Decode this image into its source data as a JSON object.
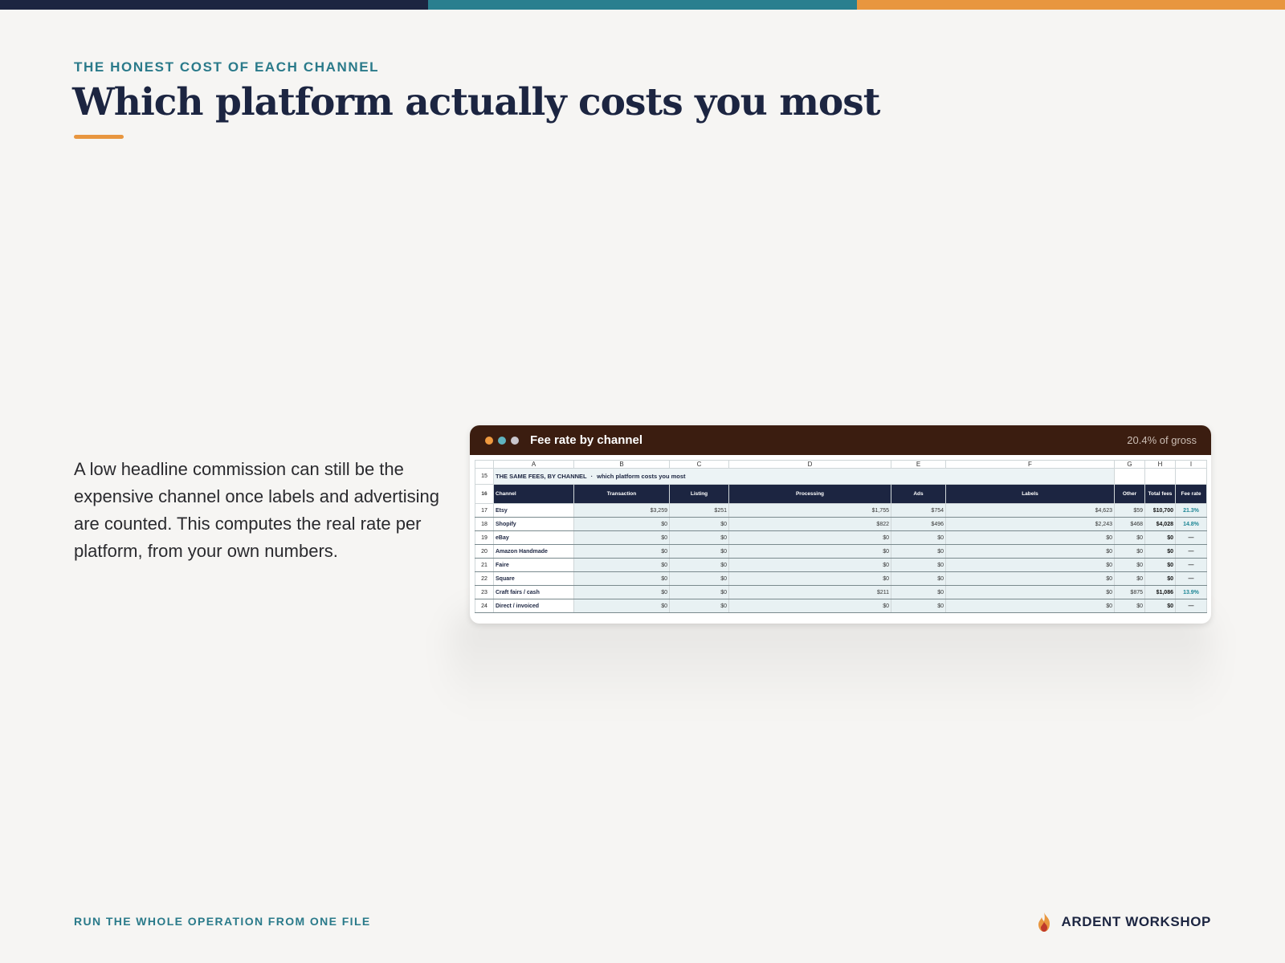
{
  "colors": {
    "navy": "#1c2541",
    "teal": "#2a7a8a",
    "orange": "#e8963f",
    "card_header": "#3b1d10",
    "dot_orange": "#ef9a3f",
    "dot_teal": "#5fb3bf",
    "dot_gray": "#c9c6cc",
    "rate_teal": "#1f8796"
  },
  "slide": {
    "eyebrow": "THE HONEST COST OF EACH CHANNEL",
    "title": "Which platform actually costs you most",
    "body": "A low headline commission can still be the expensive channel once labels and advertising are counted. This computes the real rate per platform, from your own numbers."
  },
  "card": {
    "title": "Fee rate by channel",
    "badge": "20.4% of gross"
  },
  "sheet": {
    "column_letters": [
      "A",
      "B",
      "C",
      "D",
      "E",
      "F",
      "G",
      "H",
      "I"
    ],
    "section": {
      "row": "15",
      "label": "THE SAME FEES, BY CHANNEL",
      "separator": "·",
      "sublabel": "which platform costs you most"
    },
    "header": {
      "row": "16",
      "cells": [
        "Channel",
        "Transaction",
        "Listing",
        "Processing",
        "Ads",
        "Labels",
        "Other",
        "Total fees",
        "Fee rate"
      ]
    },
    "rows": [
      {
        "row": "17",
        "cells": [
          "Etsy",
          "$3,259",
          "$251",
          "$1,755",
          "$754",
          "$4,623",
          "$59",
          "$10,700",
          "21.3%"
        ]
      },
      {
        "row": "18",
        "cells": [
          "Shopify",
          "$0",
          "$0",
          "$822",
          "$496",
          "$2,243",
          "$468",
          "$4,028",
          "14.8%"
        ]
      },
      {
        "row": "19",
        "cells": [
          "eBay",
          "$0",
          "$0",
          "$0",
          "$0",
          "$0",
          "$0",
          "$0",
          "—"
        ]
      },
      {
        "row": "20",
        "cells": [
          "Amazon Handmade",
          "$0",
          "$0",
          "$0",
          "$0",
          "$0",
          "$0",
          "$0",
          "—"
        ]
      },
      {
        "row": "21",
        "cells": [
          "Faire",
          "$0",
          "$0",
          "$0",
          "$0",
          "$0",
          "$0",
          "$0",
          "—"
        ]
      },
      {
        "row": "22",
        "cells": [
          "Square",
          "$0",
          "$0",
          "$0",
          "$0",
          "$0",
          "$0",
          "$0",
          "—"
        ]
      },
      {
        "row": "23",
        "cells": [
          "Craft fairs / cash",
          "$0",
          "$0",
          "$211",
          "$0",
          "$0",
          "$875",
          "$1,086",
          "13.9%"
        ]
      },
      {
        "row": "24",
        "cells": [
          "Direct / invoiced",
          "$0",
          "$0",
          "$0",
          "$0",
          "$0",
          "$0",
          "$0",
          "—"
        ]
      }
    ]
  },
  "footer": {
    "tagline": "RUN THE WHOLE OPERATION FROM ONE FILE",
    "brand": "ARDENT WORKSHOP",
    "brand_icon": "flame-icon"
  }
}
